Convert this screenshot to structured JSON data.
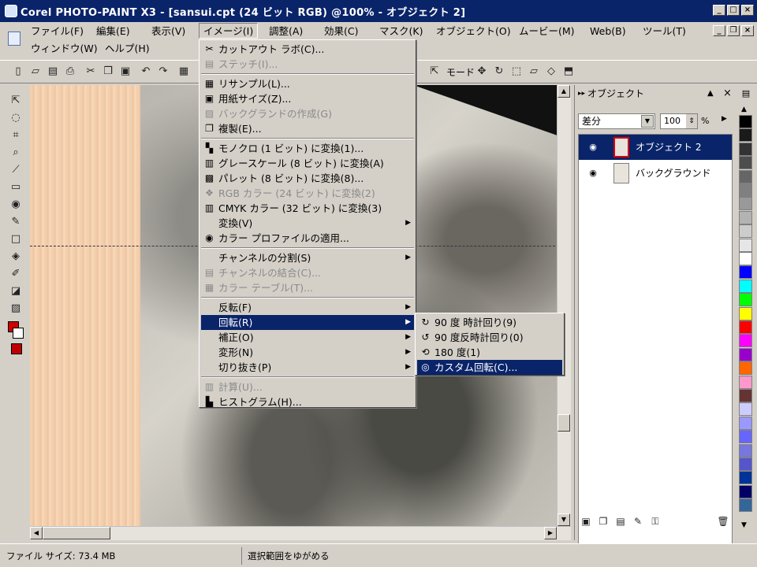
{
  "window": {
    "title": "Corel PHOTO-PAINT X3 - [sansui.cpt (24 ビット RGB) @100% - オブジェクト 2]"
  },
  "menubar": {
    "items": [
      "ファイル(F)",
      "編集(E)",
      "表示(V)",
      "イメージ(I)",
      "調整(A)",
      "効果(C)",
      "マスク(K)",
      "オブジェクト(O)",
      "ムービー(M)",
      "Web(B)",
      "ツール(T)"
    ],
    "row2": [
      "ウィンドウ(W)",
      "ヘルプ(H)"
    ]
  },
  "toolbar": {
    "mode_label": "モード"
  },
  "image_menu": {
    "items": [
      {
        "label": "カットアウト ラボ(C)...",
        "icon": "scissors-icon",
        "glyph": "✂",
        "disabled": false
      },
      {
        "label": "ステッチ(I)...",
        "icon": "stitch-icon",
        "glyph": "▤",
        "disabled": true
      },
      {
        "label": "リサンプル(L)...",
        "icon": "resample-icon",
        "glyph": "▦",
        "disabled": false
      },
      {
        "label": "用紙サイズ(Z)...",
        "icon": "paper-size-icon",
        "glyph": "▣",
        "disabled": false
      },
      {
        "label": "バックグランドの作成(G)",
        "icon": "background-icon",
        "glyph": "▨",
        "disabled": true
      },
      {
        "label": "複製(E)...",
        "icon": "duplicate-icon",
        "glyph": "❐",
        "disabled": false
      },
      {
        "label": "モノクロ (1 ビット) に変換(1)...",
        "icon": "mono-icon",
        "glyph": "▚",
        "disabled": false
      },
      {
        "label": "グレースケール (8 ビット) に変換(A)",
        "icon": "grayscale-icon",
        "glyph": "▥",
        "disabled": false
      },
      {
        "label": "パレット (8 ビット) に変換(8)...",
        "icon": "palette-icon",
        "glyph": "▩",
        "disabled": false
      },
      {
        "label": "RGB カラー (24 ビット) に変換(2)",
        "icon": "rgb-icon",
        "glyph": "❖",
        "disabled": true
      },
      {
        "label": "CMYK カラー (32 ビット) に変換(3)",
        "icon": "cmyk-icon",
        "glyph": "▥",
        "disabled": false
      },
      {
        "label": "変換(V)",
        "icon": "",
        "glyph": "",
        "disabled": false,
        "submenu": true
      },
      {
        "label": "カラー プロファイルの適用...",
        "icon": "profile-icon",
        "glyph": "◉",
        "disabled": false
      },
      {
        "label": "チャンネルの分割(S)",
        "icon": "",
        "glyph": "",
        "disabled": false,
        "submenu": true
      },
      {
        "label": "チャンネルの結合(C)...",
        "icon": "merge-icon",
        "glyph": "▤",
        "disabled": true
      },
      {
        "label": "カラー テーブル(T)...",
        "icon": "color-table-icon",
        "glyph": "▦",
        "disabled": true
      },
      {
        "label": "反転(F)",
        "icon": "",
        "glyph": "",
        "disabled": false,
        "submenu": true
      },
      {
        "label": "回転(R)",
        "icon": "",
        "glyph": "",
        "disabled": false,
        "submenu": true,
        "highlight": true
      },
      {
        "label": "補正(O)",
        "icon": "",
        "glyph": "",
        "disabled": false,
        "submenu": true
      },
      {
        "label": "変形(N)",
        "icon": "",
        "glyph": "",
        "disabled": false,
        "submenu": true
      },
      {
        "label": "切り抜き(P)",
        "icon": "",
        "glyph": "",
        "disabled": false,
        "submenu": true
      },
      {
        "label": "計算(U)...",
        "icon": "calc-icon",
        "glyph": "▥",
        "disabled": true
      },
      {
        "label": "ヒストグラム(H)...",
        "icon": "histogram-icon",
        "glyph": "▙",
        "disabled": false
      }
    ]
  },
  "rotate_submenu": {
    "items": [
      {
        "label": "90 度 時計回り(9)",
        "icon": "rotate-cw-icon",
        "glyph": "↻"
      },
      {
        "label": "90 度反時計回り(0)",
        "icon": "rotate-ccw-icon",
        "glyph": "↺"
      },
      {
        "label": "180 度(1)",
        "icon": "rotate-180-icon",
        "glyph": "⟲"
      },
      {
        "label": "カスタム回転(C)...",
        "icon": "custom-rotate-icon",
        "glyph": "◎",
        "highlight": true
      }
    ]
  },
  "object_panel": {
    "title": "オブジェクト",
    "blend_mode": "差分",
    "opacity": "100",
    "percent": "%",
    "layers": [
      {
        "name": "オブジェクト 2",
        "selected": true
      },
      {
        "name": "バックグラウンド",
        "selected": false
      }
    ]
  },
  "palette": {
    "colors": [
      "#000000",
      "#1a1a1a",
      "#333333",
      "#4d4d4d",
      "#666666",
      "#808080",
      "#999999",
      "#b3b3b3",
      "#cccccc",
      "#e6e6e6",
      "#ffffff",
      "#0000ff",
      "#00ffff",
      "#00ff00",
      "#ffff00",
      "#ff0000",
      "#ff00ff",
      "#9900cc",
      "#ff6600",
      "#ff99cc",
      "#663333",
      "#ccccff",
      "#9999ff",
      "#6666ff",
      "#7777dd",
      "#5555cc",
      "#003399",
      "#000066",
      "#336699"
    ]
  },
  "statusbar": {
    "file_size": "ファイル サイズ: 73.4 MB",
    "hint": "選択範囲をゆがめる"
  }
}
